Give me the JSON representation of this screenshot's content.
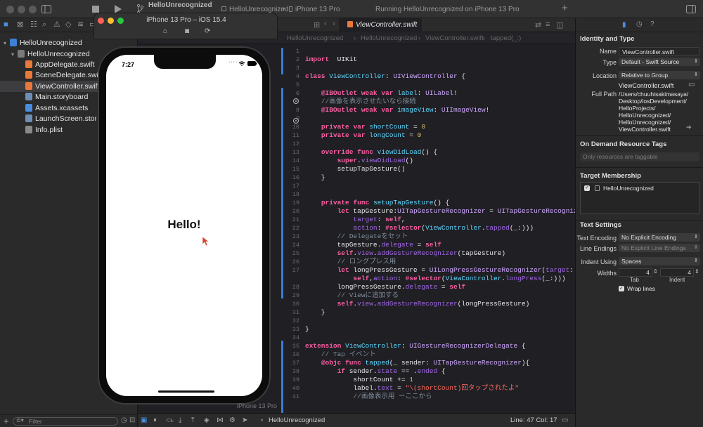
{
  "toolbar": {
    "project_title": "HelloUnrecognized",
    "branch_label": "HelloUnrecognized",
    "device_label": "iPhone 13 Pro",
    "status_text": "Running HelloUnrecognized on iPhone 13 Pro",
    "add_symbol": "+"
  },
  "navigator": {
    "root": "HelloUnrecognized",
    "group": "HelloUnrecognized",
    "files": [
      "AppDelegate.swift",
      "SceneDelegate.swift",
      "ViewController.swift",
      "Main.storyboard",
      "Assets.xcassets",
      "LaunchScreen.storyboard",
      "Info.plist"
    ],
    "filter_placeholder": "Filter"
  },
  "editor": {
    "tab_label": "ViewController.swift",
    "jump_path": [
      "HelloUnrecognized",
      "HelloUnrecognized",
      "ViewController.swift",
      "tapped(_:)"
    ],
    "lines": [
      {
        "n": "1",
        "segs": []
      },
      {
        "n": "2",
        "segs": [
          [
            "kw",
            "import"
          ],
          [
            "",
            "  UIKit"
          ]
        ]
      },
      {
        "n": "3",
        "segs": []
      },
      {
        "n": "4",
        "segs": [
          [
            "kw",
            "class"
          ],
          [
            "",
            " "
          ],
          [
            "ty",
            "ViewController"
          ],
          [
            "",
            ": "
          ],
          [
            "tp",
            "UIViewController"
          ],
          [
            "",
            " {"
          ]
        ]
      },
      {
        "n": "5",
        "segs": []
      },
      {
        "n": "6",
        "segs": [
          [
            "",
            "    "
          ],
          [
            "kw",
            "@IBOutlet"
          ],
          [
            "",
            " "
          ],
          [
            "kw",
            "weak"
          ],
          [
            "",
            " "
          ],
          [
            "kw",
            "var"
          ],
          [
            "",
            " "
          ],
          [
            "ty",
            "label"
          ],
          [
            "",
            ": "
          ],
          [
            "tp",
            "UILabel"
          ],
          [
            "",
            "!"
          ]
        ]
      },
      {
        "n": "7",
        "segs": [
          [
            "cm",
            "    //画像を表示させたいなら接続"
          ]
        ]
      },
      {
        "n": "8",
        "segs": [
          [
            "",
            "    "
          ],
          [
            "kw",
            "@IBOutlet"
          ],
          [
            "",
            " "
          ],
          [
            "kw",
            "weak"
          ],
          [
            "",
            " "
          ],
          [
            "kw",
            "var"
          ],
          [
            "",
            " "
          ],
          [
            "ty",
            "imageView"
          ],
          [
            "",
            ": "
          ],
          [
            "tp",
            "UIImageView"
          ],
          [
            "",
            "!"
          ]
        ]
      },
      {
        "n": "9",
        "segs": []
      },
      {
        "n": "10",
        "segs": [
          [
            "",
            "    "
          ],
          [
            "kw",
            "private"
          ],
          [
            "",
            " "
          ],
          [
            "kw",
            "var"
          ],
          [
            "",
            " "
          ],
          [
            "ty",
            "shortCount"
          ],
          [
            "",
            " = "
          ],
          [
            "nm",
            "0"
          ]
        ]
      },
      {
        "n": "11",
        "segs": [
          [
            "",
            "    "
          ],
          [
            "kw",
            "private"
          ],
          [
            "",
            " "
          ],
          [
            "kw",
            "var"
          ],
          [
            "",
            " "
          ],
          [
            "ty",
            "longCount"
          ],
          [
            "",
            " = "
          ],
          [
            "nm",
            "0"
          ]
        ]
      },
      {
        "n": "12",
        "segs": []
      },
      {
        "n": "13",
        "segs": [
          [
            "",
            "    "
          ],
          [
            "kw",
            "override"
          ],
          [
            "",
            " "
          ],
          [
            "kw",
            "func"
          ],
          [
            "",
            " "
          ],
          [
            "ty",
            "viewDidLoad"
          ],
          [
            "",
            "() {"
          ]
        ]
      },
      {
        "n": "14",
        "segs": [
          [
            "",
            "        "
          ],
          [
            "kw",
            "super"
          ],
          [
            "",
            "."
          ],
          [
            "md",
            "viewDidLoad"
          ],
          [
            "",
            "()"
          ]
        ]
      },
      {
        "n": "15",
        "segs": [
          [
            "",
            "        setupTapGesture()"
          ]
        ]
      },
      {
        "n": "16",
        "segs": [
          [
            "",
            "    }"
          ]
        ]
      },
      {
        "n": "17",
        "segs": []
      },
      {
        "n": "18",
        "segs": []
      },
      {
        "n": "19",
        "segs": [
          [
            "",
            "    "
          ],
          [
            "kw",
            "private"
          ],
          [
            "",
            " "
          ],
          [
            "kw",
            "func"
          ],
          [
            "",
            " "
          ],
          [
            "ty",
            "setupTapGesture"
          ],
          [
            "",
            "() {"
          ]
        ]
      },
      {
        "n": "20",
        "segs": [
          [
            "",
            "        "
          ],
          [
            "kw",
            "let"
          ],
          [
            "",
            " tapGesture:"
          ],
          [
            "tp",
            "UITapGestureRecognizer"
          ],
          [
            "",
            " = "
          ],
          [
            "tp",
            "UITapGestureRecognizer"
          ],
          [
            "",
            "("
          ]
        ]
      },
      {
        "n": "21",
        "segs": [
          [
            "",
            "            "
          ],
          [
            "md",
            "target"
          ],
          [
            "",
            ": "
          ],
          [
            "kw",
            "self"
          ],
          [
            "",
            ","
          ]
        ]
      },
      {
        "n": "22",
        "segs": [
          [
            "",
            "            "
          ],
          [
            "md",
            "action"
          ],
          [
            "",
            ": "
          ],
          [
            "kw",
            "#selector"
          ],
          [
            "",
            "("
          ],
          [
            "ty",
            "ViewController"
          ],
          [
            "",
            "."
          ],
          [
            "md",
            "tapped"
          ],
          [
            "",
            "(_:)))"
          ]
        ]
      },
      {
        "n": "23",
        "segs": [
          [
            "cm",
            "        // Delegateをセット"
          ]
        ]
      },
      {
        "n": "24",
        "segs": [
          [
            "",
            "        tapGesture."
          ],
          [
            "md",
            "delegate"
          ],
          [
            "",
            " = "
          ],
          [
            "kw",
            "self"
          ]
        ]
      },
      {
        "n": "25",
        "segs": [
          [
            "",
            "        "
          ],
          [
            "kw",
            "self"
          ],
          [
            "",
            "."
          ],
          [
            "md",
            "view"
          ],
          [
            "",
            "."
          ],
          [
            "md",
            "addGestureRecognizer"
          ],
          [
            "",
            "(tapGesture)"
          ]
        ]
      },
      {
        "n": "26",
        "segs": [
          [
            "cm",
            "        // ロングプレス用"
          ]
        ]
      },
      {
        "n": "27",
        "segs": [
          [
            "",
            "        "
          ],
          [
            "kw",
            "let"
          ],
          [
            "",
            " longPressGesture = "
          ],
          [
            "tp",
            "UILongPressGestureRecognizer"
          ],
          [
            "",
            "("
          ],
          [
            "md",
            "target"
          ],
          [
            "",
            ":"
          ]
        ]
      },
      {
        "n": "",
        "segs": [
          [
            "",
            "            "
          ],
          [
            "kw",
            "self"
          ],
          [
            "",
            ","
          ],
          [
            "md",
            "action"
          ],
          [
            "",
            ": "
          ],
          [
            "kw",
            "#selector"
          ],
          [
            "",
            "("
          ],
          [
            "ty",
            "ViewController"
          ],
          [
            "",
            "."
          ],
          [
            "md",
            "longPress"
          ],
          [
            "",
            "(_:)))"
          ]
        ]
      },
      {
        "n": "28",
        "segs": [
          [
            "",
            "        longPressGesture."
          ],
          [
            "md",
            "delegate"
          ],
          [
            "",
            " = "
          ],
          [
            "kw",
            "self"
          ]
        ]
      },
      {
        "n": "29",
        "segs": [
          [
            "cm",
            "        // Viewに追加する"
          ]
        ]
      },
      {
        "n": "30",
        "segs": [
          [
            "",
            "        "
          ],
          [
            "kw",
            "self"
          ],
          [
            "",
            "."
          ],
          [
            "md",
            "view"
          ],
          [
            "",
            "."
          ],
          [
            "md",
            "addGestureRecognizer"
          ],
          [
            "",
            "(longPressGesture)"
          ]
        ]
      },
      {
        "n": "31",
        "segs": [
          [
            "",
            "    }"
          ]
        ]
      },
      {
        "n": "32",
        "segs": []
      },
      {
        "n": "33",
        "segs": [
          [
            "",
            "}"
          ]
        ]
      },
      {
        "n": "34",
        "segs": []
      },
      {
        "n": "35",
        "segs": [
          [
            "kw",
            "extension"
          ],
          [
            "",
            " "
          ],
          [
            "ty",
            "ViewController"
          ],
          [
            "",
            ": "
          ],
          [
            "tp",
            "UIGestureRecognizerDelegate"
          ],
          [
            "",
            " {"
          ]
        ]
      },
      {
        "n": "36",
        "segs": [
          [
            "cm",
            "    // Tap イベント"
          ]
        ]
      },
      {
        "n": "37",
        "segs": [
          [
            "",
            "    "
          ],
          [
            "kw",
            "@objc"
          ],
          [
            "",
            " "
          ],
          [
            "kw",
            "func"
          ],
          [
            "",
            " "
          ],
          [
            "ty",
            "tapped"
          ],
          [
            "",
            "(_ sender: "
          ],
          [
            "tp",
            "UITapGestureRecognizer"
          ],
          [
            "",
            "){"
          ]
        ]
      },
      {
        "n": "38",
        "segs": [
          [
            "",
            "        "
          ],
          [
            "kw",
            "if"
          ],
          [
            "",
            " sender."
          ],
          [
            "md",
            "state"
          ],
          [
            "",
            " == ."
          ],
          [
            "md",
            "ended"
          ],
          [
            "",
            " {"
          ]
        ]
      },
      {
        "n": "39",
        "segs": [
          [
            "",
            "            shortCount += "
          ],
          [
            "nm",
            "1"
          ]
        ]
      },
      {
        "n": "40",
        "segs": [
          [
            "",
            "            label."
          ],
          [
            "md",
            "text"
          ],
          [
            "",
            " = "
          ],
          [
            "st",
            "\"\\(shortCount)回タップされたよ\""
          ]
        ]
      },
      {
        "n": "41",
        "segs": [
          [
            "cm",
            "            //画像表示用 ーここから"
          ]
        ]
      }
    ],
    "status": {
      "scheme": "HelloUnrecognized",
      "line_col": "Line: 47  Col: 17"
    }
  },
  "simulator": {
    "title": "iPhone 13 Pro – iOS 15.4",
    "time": "7:27",
    "label_text": "Hello!",
    "bottom_label": "iPhone 13 Pro"
  },
  "inspector": {
    "identity_header": "Identity and Type",
    "name_label": "Name",
    "name_value": "ViewController.swift",
    "type_label": "Type",
    "type_value": "Default - Swift Source",
    "location_label": "Location",
    "location_value": "Relative to Group",
    "location_file": "ViewController.swift",
    "fullpath_label": "Full Path",
    "fullpath_lines": [
      "/Users/chuuhisakimasaya/",
      "Desktop/iosDevelopment/",
      "HelloProjects/",
      "HelloUnrecognized/",
      "HelloUnrecognized/",
      "ViewController.swift"
    ],
    "odr_header": "On Demand Resource Tags",
    "odr_placeholder": "Only resources are taggable",
    "membership_header": "Target Membership",
    "membership_item": "HelloUnrecognized",
    "text_header": "Text Settings",
    "encoding_label": "Text Encoding",
    "encoding_value": "No Explicit Encoding",
    "endings_label": "Line Endings",
    "endings_value": "No Explicit Line Endings",
    "indent_label": "Indent Using",
    "indent_value": "Spaces",
    "widths_label": "Widths",
    "tab_width": "4",
    "indent_width": "4",
    "tab_caption": "Tab",
    "indent_caption": "Indent",
    "wrap_label": "Wrap lines"
  }
}
